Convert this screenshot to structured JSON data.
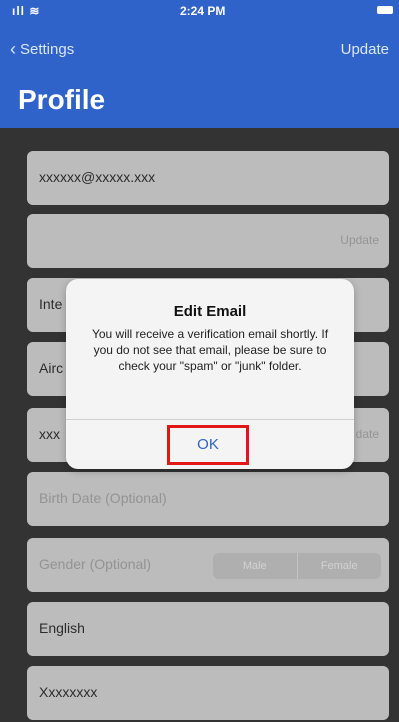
{
  "status_bar": {
    "time": "2:24 PM"
  },
  "nav": {
    "back_label": "Settings",
    "update_label": "Update"
  },
  "header": {
    "title": "Profile"
  },
  "fields": {
    "email": "xxxxxx@xxxxx.xxx",
    "email_update": "Update",
    "field3_partial": "Inte",
    "field4_partial": "Airc",
    "field5_partial": "xxx",
    "field5_update_partial": "date",
    "birth_date_placeholder": "Birth Date (Optional)",
    "gender_placeholder": "Gender (Optional)",
    "gender_options": [
      "Male",
      "Female"
    ],
    "language": "English",
    "last_field": "Xxxxxxxx"
  },
  "dialog": {
    "title": "Edit Email",
    "message": "You will receive a verification email shortly. If you do not see that email, please be sure to check your \"spam\" or \"junk\" folder.",
    "ok_label": "OK"
  }
}
